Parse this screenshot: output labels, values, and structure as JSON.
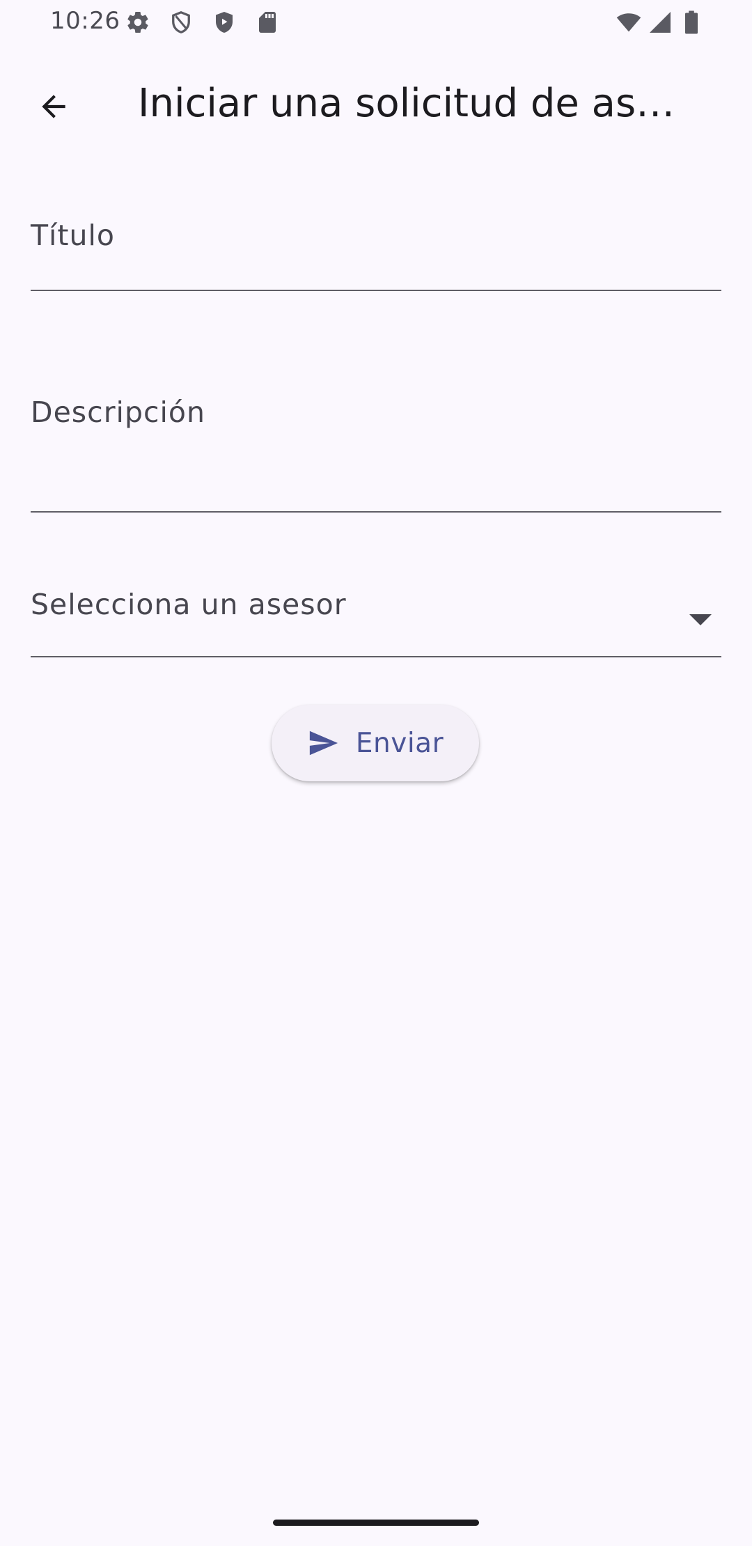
{
  "status_bar": {
    "time": "10:26",
    "left_icons": [
      "settings-gear-icon",
      "shield-icon",
      "play-shield-icon",
      "sd-card-icon"
    ],
    "right_icons": [
      "wifi-icon",
      "cell-signal-icon",
      "battery-icon"
    ]
  },
  "app_bar": {
    "back_icon": "arrow-back-icon",
    "title": "Iniciar una solicitud de as…"
  },
  "form": {
    "title_field": {
      "label": "Título",
      "value": ""
    },
    "description_field": {
      "label": "Descripción",
      "value": ""
    },
    "advisor_select": {
      "label": "Selecciona un asesor",
      "icon": "dropdown-arrow-icon"
    },
    "send_button": {
      "label": "Enviar",
      "icon": "send-icon"
    }
  },
  "colors": {
    "background": "#fbf8fe",
    "primary": "#4a5496",
    "on_surface": "#1c1b1f",
    "field_line": "#5f5e66"
  }
}
